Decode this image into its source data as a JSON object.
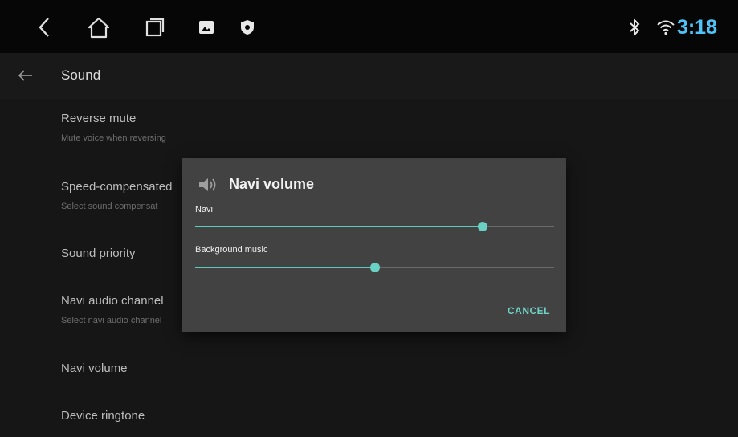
{
  "status_bar": {
    "time": "3:18",
    "accent_color": "#4fc3f7",
    "icons": [
      "back-icon",
      "home-icon",
      "recent-apps-icon",
      "gallery-icon",
      "shield-icon",
      "bluetooth-icon",
      "wifi-icon"
    ]
  },
  "app_bar": {
    "title": "Sound"
  },
  "settings": [
    {
      "title": "Reverse mute",
      "subtitle": "Mute voice when reversing"
    },
    {
      "title": "Speed-compensated",
      "subtitle": "Select sound compensat"
    },
    {
      "title": "Sound priority",
      "subtitle": ""
    },
    {
      "title": "Navi audio channel",
      "subtitle": "Select navi audio channel"
    },
    {
      "title": "Navi volume",
      "subtitle": ""
    },
    {
      "title": "Device ringtone",
      "subtitle": ""
    }
  ],
  "dialog": {
    "title": "Navi volume",
    "icon": "speaker-icon",
    "sliders": [
      {
        "label": "Navi",
        "value": 0.8
      },
      {
        "label": "Background music",
        "value": 0.5
      }
    ],
    "cancel_label": "CANCEL",
    "accent_color": "#5ccbbd"
  }
}
